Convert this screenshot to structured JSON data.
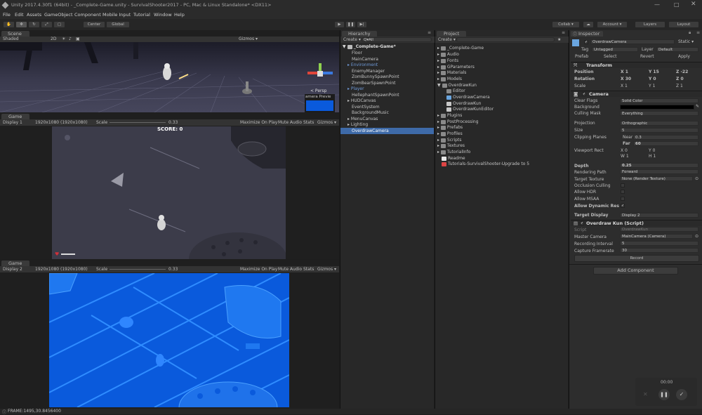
{
  "titlebar": {
    "text": "Unity 2017.4.30f1 (64bit) - _Complete-Game.unity - SurvivalShooter2017 - PC, Mac & Linux Standalone* <DX11>"
  },
  "menu": [
    "File",
    "Edit",
    "Assets",
    "GameObject",
    "Component",
    "Mobile Input",
    "Tutorial",
    "Window",
    "Help"
  ],
  "toolbar": {
    "center": "Center",
    "global": "Global",
    "collab": "Collab ▾",
    "account": "Account ▾",
    "layers": "Layers",
    "layout": "Layout"
  },
  "scene": {
    "tab": "Scene",
    "shaded": "Shaded",
    "mode2d": "2D",
    "gizmos": "Gizmos ▾",
    "persp": "< Persp",
    "camera_preview": "amera Previe"
  },
  "game1": {
    "tab": "Game",
    "display": "Display 1",
    "resolution": "1920x1080 (1920x1080)",
    "scale_label": "Scale",
    "scale_value": "0.33",
    "maximize": "Maximize On Play",
    "mute": "Mute Audio",
    "stats": "Stats",
    "gizmos": "Gizmos ▾",
    "score": "SCORE: 0"
  },
  "game2": {
    "tab": "Game",
    "display": "Display 2",
    "resolution": "1920x1080 (1920x1080)",
    "scale_label": "Scale",
    "scale_value": "0.33",
    "maximize": "Maximize On Play",
    "mute": "Mute Audio",
    "stats": "Stats",
    "gizmos": "Gizmos ▾"
  },
  "hierarchy": {
    "tab": "Hierarchy",
    "create": "Create ▾",
    "search": "Q▾All",
    "scene_name": "_Complete-Game*",
    "items": [
      "Floor",
      "MainCamera",
      "Environment",
      "EnemyManager",
      "ZomBunnySpawnPoint",
      "ZomBearSpawnPoint",
      "Player",
      "HellephantSpawnPoint",
      "HUDCanvas",
      "EventSystem",
      "BackgroundMusic",
      "MenuCanvas",
      "Lighting",
      "OverdrawCamera"
    ]
  },
  "project": {
    "tab": "Project",
    "create": "Create ▾",
    "items": [
      "_Complete-Game",
      "Audio",
      "Fonts",
      "GParameters",
      "Materials",
      "Models",
      "OverdrawKun",
      "Editor",
      "OverdrawCamera",
      "OverdrawKun",
      "OverdrawKunEditor",
      "Plugins",
      "PostProcessing",
      "Prefabs",
      "Profiles",
      "Scripts",
      "Textures",
      "TutorialInfo",
      "Readme",
      "Tutorials-SurvivalShooter-Upgrade to 5"
    ]
  },
  "inspector": {
    "tab": "Inspector",
    "name": "OverdrawCamera",
    "static": "Static ▾",
    "tag_label": "Tag",
    "tag": "Untagged",
    "layer_label": "Layer",
    "layer": "Default",
    "prefab": "Prefab",
    "select": "Select",
    "revert": "Revert",
    "apply": "Apply",
    "transform": {
      "title": "Transform",
      "position": "Position",
      "rotation": "Rotation",
      "scale": "Scale",
      "px": "X 1",
      "py": "Y 15",
      "pz": "Z -22",
      "rx": "X 30",
      "ry": "Y 0",
      "rz": "Z 0",
      "sx": "X 1",
      "sy": "Y 1",
      "sz": "Z 1"
    },
    "camera": {
      "title": "Camera",
      "clear_flags": "Clear Flags",
      "clear_flags_v": "Solid Color",
      "background": "Background",
      "culling_mask": "Culling Mask",
      "culling_mask_v": "Everything",
      "projection": "Projection",
      "projection_v": "Orthographic",
      "size": "Size",
      "size_v": "5",
      "clipping": "Clipping Planes",
      "near": "Near",
      "near_v": "0.3",
      "far": "Far",
      "far_v": "60",
      "viewport": "Viewport Rect",
      "vx": "X 0",
      "vy": "Y 0",
      "vw": "W 1",
      "vh": "H 1",
      "depth": "Depth",
      "depth_v": "0.25",
      "rendering_path": "Rendering Path",
      "rendering_path_v": "Forward",
      "target_texture": "Target Texture",
      "target_texture_v": "None (Render Texture)",
      "occlusion": "Occlusion Culling",
      "hdr": "Allow HDR",
      "msaa": "Allow MSAA",
      "dynres": "Allow Dynamic Res",
      "target_display": "Target Display",
      "target_display_v": "Display 2"
    },
    "script": {
      "title": "Overdraw Kun (Script)",
      "script_label": "Script",
      "script_v": "OverdrawKun",
      "master": "Master Camera",
      "master_v": "MainCamera (Camera)",
      "interval": "Recording Interval",
      "interval_v": "5",
      "framerate": "Capture Framerate",
      "framerate_v": "30",
      "record": "Record"
    },
    "add_component": "Add Component"
  },
  "overlay": {
    "time": "00:00"
  },
  "status": {
    "text": "FRAME:1495,30.8456400"
  },
  "colors": {
    "selection": "#3e6aa8",
    "game2_bg": "#0a5adc",
    "bg": "#1e1e1e"
  }
}
